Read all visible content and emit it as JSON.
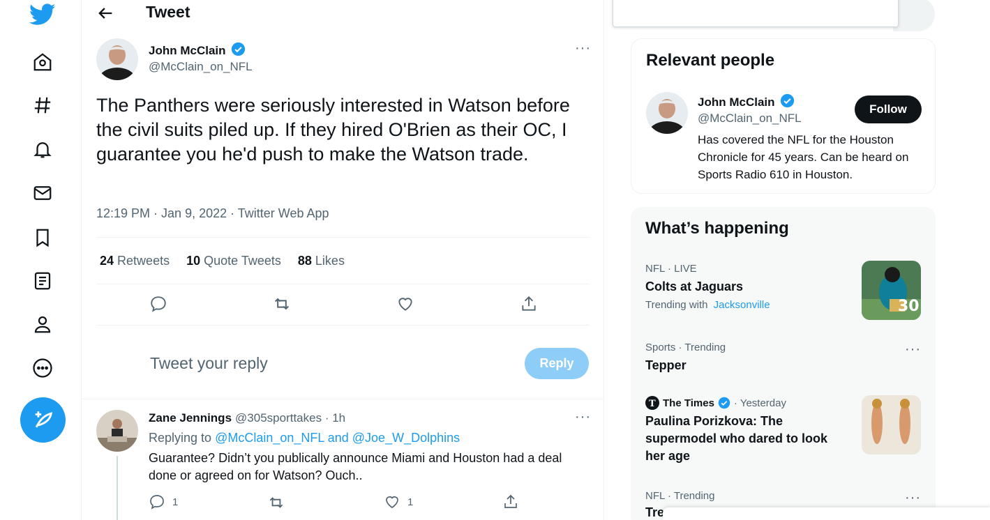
{
  "header": {
    "title": "Tweet"
  },
  "nav": [
    "twitter-logo",
    "home",
    "explore",
    "notifications",
    "messages",
    "bookmarks",
    "lists",
    "profile",
    "more"
  ],
  "tweet": {
    "author_name": "John McClain",
    "author_handle": "@McClain_on_NFL",
    "text": "The Panthers were seriously interested in Watson before the civil suits piled up. If they hired O'Brien as their OC, I guarantee you he'd push to make the Watson trade.",
    "meta": "12:19 PM · Jan 9, 2022 · Twitter Web App",
    "retweets_count": "24",
    "retweets_label": "Retweets",
    "quotes_count": "10",
    "quotes_label": "Quote Tweets",
    "likes_count": "88",
    "likes_label": "Likes",
    "more": "···"
  },
  "reply_box": {
    "placeholder": "Tweet your reply",
    "button": "Reply"
  },
  "reply": {
    "author_name": "Zane Jennings",
    "author_handle": "@305sporttakes · 1h",
    "replying_prefix": "Replying to",
    "replying_to": "@McClain_on_NFL and @Joe_W_Dolphins",
    "text": "Guarantee? Didn’t you publically announce Miami and Houston had a deal done or agreed on for Watson? Ouch..",
    "reply_count": "1",
    "like_count": "1",
    "more": "···"
  },
  "relevant": {
    "title": "Relevant people",
    "name": "John McClain",
    "handle": "@McClain_on_NFL",
    "follow": "Follow",
    "bio": "Has covered the NFL for the Houston Chronicle for 45 years. Can be heard on Sports Radio 610 in Houston."
  },
  "happening": {
    "title": "What’s happening",
    "trends": [
      {
        "category": "NFL · LIVE",
        "title": "Colts at Jaguars",
        "sub_prefix": "Trending with",
        "sub_link": "Jacksonville"
      },
      {
        "category": "Sports · Trending",
        "title": "Tepper",
        "more": "···"
      },
      {
        "source": "The Times",
        "time": "· Yesterday",
        "title": "Paulina Porizkova: The supermodel who dared to look her age"
      },
      {
        "category": "NFL · Trending",
        "title": "Tre",
        "more": "···"
      }
    ]
  },
  "colors": {
    "accent": "#1d9bf0",
    "text": "#0f1419",
    "muted": "#536471"
  }
}
